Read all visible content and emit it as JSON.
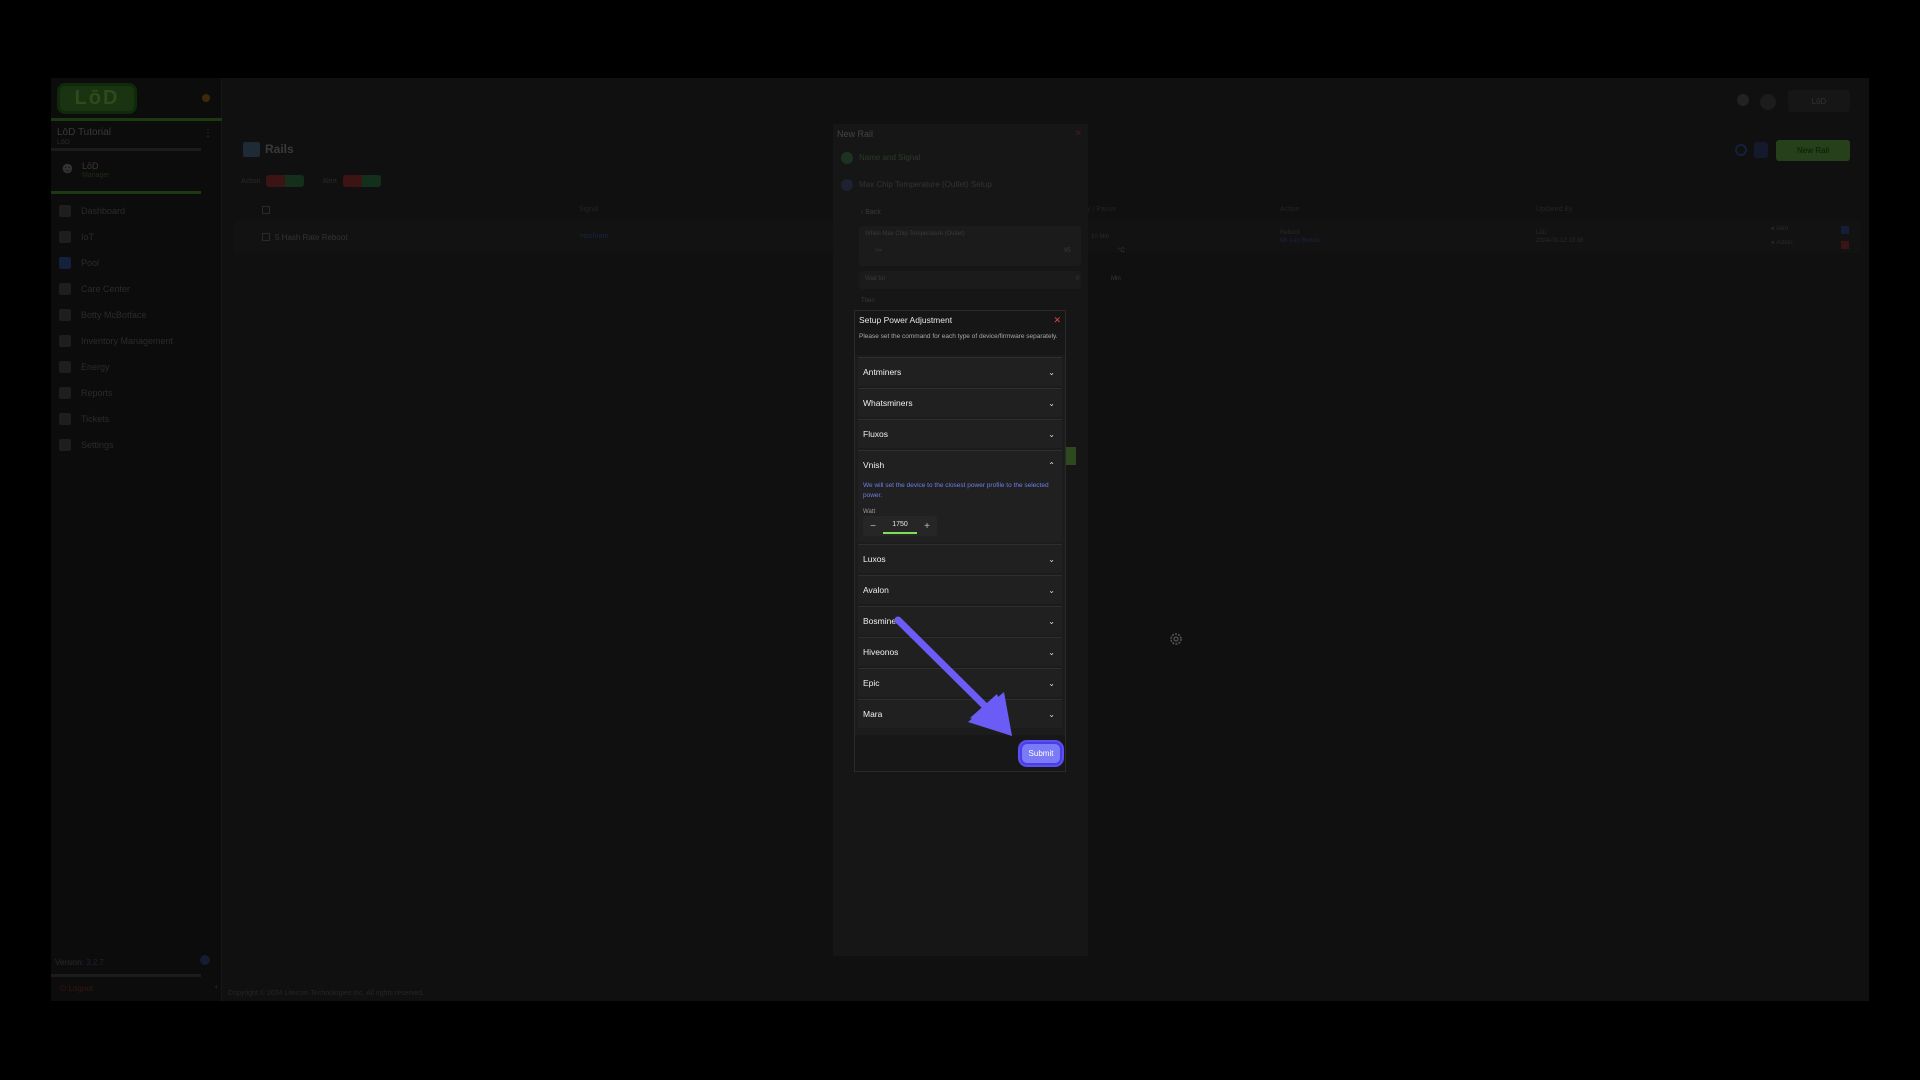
{
  "sidebar": {
    "logo": "LōD",
    "org_title": "LōD Tutorial",
    "org_sub": "LōD",
    "user_name": "LōD",
    "user_role": "Manager",
    "items": [
      {
        "label": "Dashboard"
      },
      {
        "label": "IoT"
      },
      {
        "label": "Pool"
      },
      {
        "label": "Care Center"
      },
      {
        "label": "Botty McBotface"
      },
      {
        "label": "Inventory Management"
      },
      {
        "label": "Energy"
      },
      {
        "label": "Reports"
      },
      {
        "label": "Tickets"
      },
      {
        "label": "Settings"
      }
    ],
    "version_label": "Version:",
    "version": "3.2.7",
    "logout": "Logout"
  },
  "main": {
    "title": "Rails",
    "filter_action": "Action",
    "filter_alert": "Alert",
    "new_rail": "New Rail",
    "user_button": "LōD",
    "columns": [
      "Signal",
      "y / Pause",
      "Action",
      "Updated By"
    ],
    "row": {
      "name": "5 Hash Rate Reboot",
      "signal": "Hashrate",
      "pause": "10 Min",
      "action": "Reboot",
      "action_sub": "Mr. Leo Bertolo",
      "updated_by": "LōD",
      "updated_at": "2024-01-12 10:38",
      "toggle_alert": "Alert",
      "toggle_action": "Action"
    },
    "copyright": "Copyright © 2024 Litecoin Technologies Inc. All rights reserved."
  },
  "background_modal": {
    "title": "New Rail",
    "step1": "Name and Signal",
    "step2": "Max Chip Temperature (Outlet) Setup",
    "back": "Back",
    "when_label": "When Max Chip Temperature (Outlet)",
    "operator": ">=",
    "temp_value": "95",
    "temp_unit": "°C",
    "wait_label": "Wait for",
    "wait_value": "0",
    "wait_unit": "Min",
    "then_label": "Then"
  },
  "power_modal": {
    "title": "Setup Power Adjustment",
    "description": "Please set the command for each type of device/firmware separately.",
    "sections": [
      {
        "label": "Antminers",
        "expanded": false
      },
      {
        "label": "Whatsminers",
        "expanded": false
      },
      {
        "label": "Fluxos",
        "expanded": false
      },
      {
        "label": "Vnish",
        "expanded": true
      },
      {
        "label": "Luxos",
        "expanded": false
      },
      {
        "label": "Avalon",
        "expanded": false
      },
      {
        "label": "Bosminer",
        "expanded": false
      },
      {
        "label": "Hiveonos",
        "expanded": false
      },
      {
        "label": "Epic",
        "expanded": false
      },
      {
        "label": "Mara",
        "expanded": false
      }
    ],
    "vnish_note": "We will set the device to the closest power profile to the selected power.",
    "watt_label": "Watt",
    "watt_value": "1750",
    "minus": "−",
    "plus": "+",
    "submit": "Submit"
  },
  "colors": {
    "accent_purple": "#7b7af7",
    "green": "#7ee05a",
    "close_red": "#e04848"
  }
}
